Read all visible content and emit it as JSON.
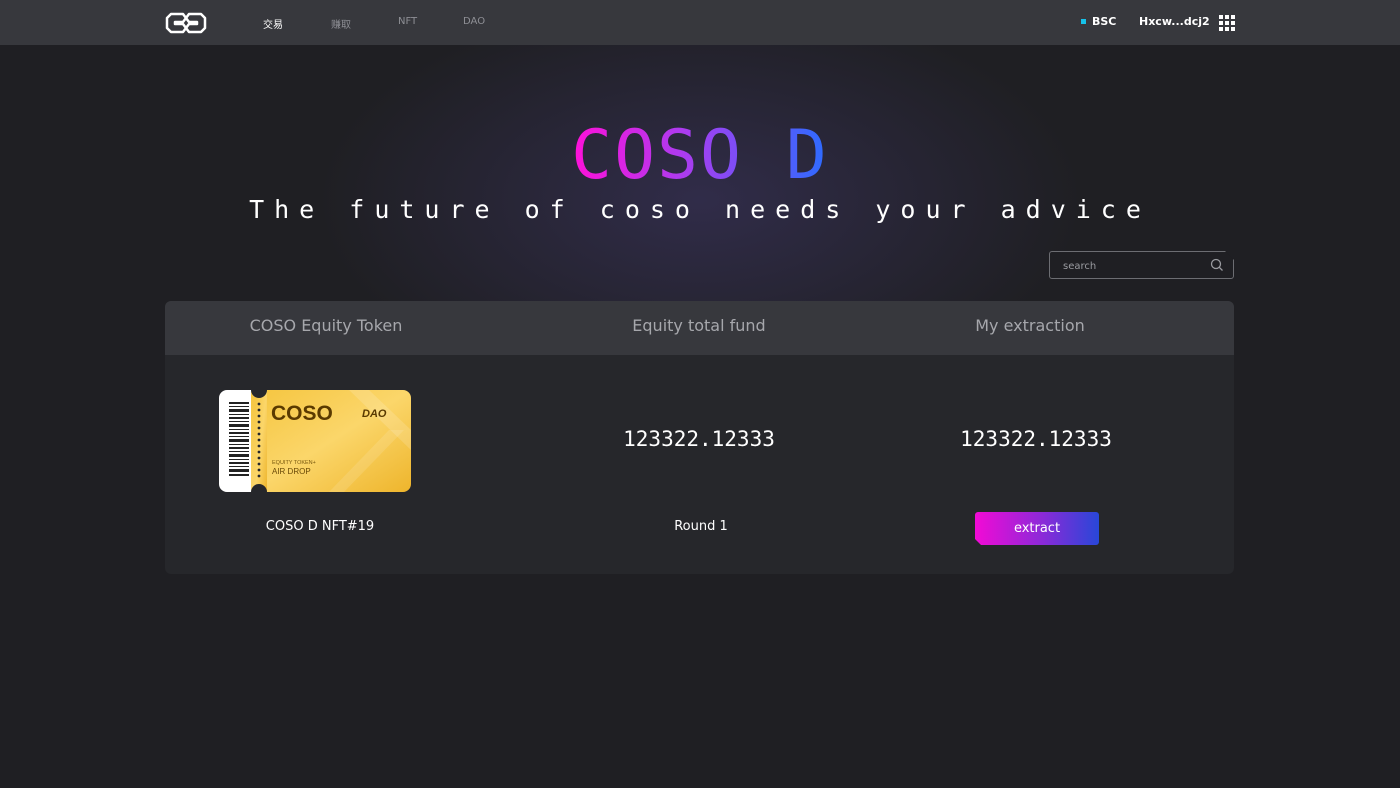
{
  "nav": {
    "logo_icon": "coso-logo-icon",
    "items": [
      {
        "label": "交易",
        "active": true
      },
      {
        "label": "赚取",
        "active": false
      },
      {
        "label": "NFT",
        "active": false
      },
      {
        "label": "DAO",
        "active": false
      }
    ],
    "network": "BSC",
    "network_color": "#16c2e9",
    "wallet": "Hxcw...dcj2",
    "menu_icon": "grid-menu-icon"
  },
  "hero": {
    "title": "COSO D",
    "subtitle": "The future of coso needs your advice",
    "title_gradient": [
      "#ff10d8",
      "#a93df0",
      "#2b6cff"
    ]
  },
  "search": {
    "placeholder": "search",
    "value": "",
    "icon": "search-icon"
  },
  "table": {
    "headers": [
      "COSO Equity Token",
      "Equity total fund",
      "My extraction"
    ],
    "row": {
      "ticket": {
        "brand": "COSO",
        "badge": "DAO",
        "line1": "EQUITY TOKEN+",
        "line2": "AIR DROP"
      },
      "token_name": "COSO D NFT#19",
      "total_fund": "123322.12333",
      "round": "Round 1",
      "my_extraction": "123322.12333",
      "extract_label": "extract"
    }
  }
}
